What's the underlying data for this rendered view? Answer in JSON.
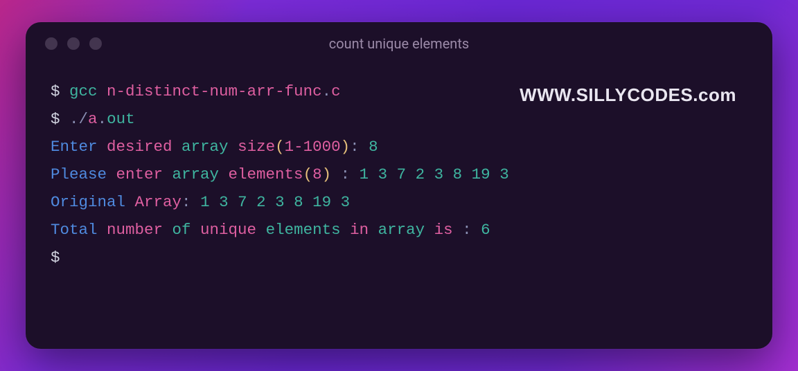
{
  "titlebar": {
    "title": "count unique elements"
  },
  "watermark": "WWW.SILLYCODES.com",
  "terminal": {
    "prompt": "$",
    "lines": {
      "l1": {
        "prompt": "$ ",
        "cmd": "gcc ",
        "file_base": "n-distinct-num-arr-func",
        "dot": ".",
        "ext": "c"
      },
      "l2": {
        "prompt": "$ ",
        "dot1": ".",
        "slash": "/",
        "a": "a",
        "dot2": ".",
        "out": "out"
      },
      "l3": {
        "w1": "Enter ",
        "w2": "desired ",
        "w3": "array ",
        "w4": "size",
        "lp": "(",
        "range_a": "1",
        "dash": "-",
        "range_b": "1000",
        "rp": ")",
        "colon": ": ",
        "val": "8"
      },
      "l4": {
        "w1": "Please ",
        "w2": "enter ",
        "w3": "array ",
        "w4": "elements",
        "lp": "(",
        "n": "8",
        "rp": ")",
        "spc": " ",
        "colon": ": ",
        "vals": "1 3 7 2 3 8 19 3"
      },
      "l5": {
        "w1": "Original ",
        "w2": "Array",
        "colon": ": ",
        "vals": "1 3 7 2 3 8 19 3"
      },
      "l6": {
        "w1": "Total ",
        "w2": "number ",
        "w3": "of ",
        "w4": "unique ",
        "w5": "elements ",
        "w6": "in ",
        "w7": "array ",
        "w8": "is ",
        "colon": ": ",
        "val": "6"
      },
      "l7": {
        "prompt": "$ "
      }
    }
  }
}
